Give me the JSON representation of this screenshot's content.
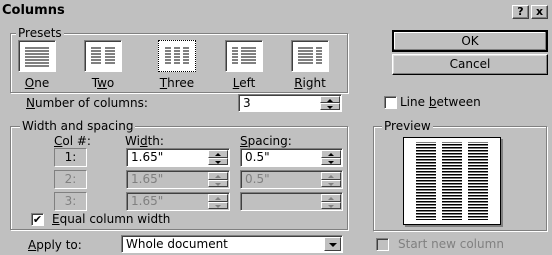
{
  "dialog": {
    "title": "Columns",
    "help_label": "?",
    "close_label": "x"
  },
  "presets": {
    "label": "Presets",
    "items": [
      {
        "label": "One",
        "mnemonic": "O",
        "rest": "ne"
      },
      {
        "label": "Two",
        "mnemonic_pre": "T",
        "mnemonic": "w",
        "rest": "o"
      },
      {
        "label": "Three",
        "mnemonic": "T",
        "rest": "hree"
      },
      {
        "label": "Left",
        "mnemonic": "L",
        "rest": "eft"
      },
      {
        "label": "Right",
        "mnemonic": "R",
        "rest": "ight"
      }
    ]
  },
  "buttons": {
    "ok": "OK",
    "cancel": "Cancel"
  },
  "number_of_columns": {
    "label_mnemonic": "N",
    "label_rest": "umber of columns:",
    "value": "3"
  },
  "line_between": {
    "label_pre": "Line ",
    "label_mnemonic": "b",
    "label_rest": "etween",
    "checked": false
  },
  "width_spacing": {
    "label": "Width and spacing",
    "col_header_mnemonic": "C",
    "col_header_rest": "ol #:",
    "width_header_pre": "Wi",
    "width_header_mnemonic": "d",
    "width_header_rest": "th:",
    "spacing_header_mnemonic": "S",
    "spacing_header_rest": "pacing:",
    "rows": [
      {
        "col": "1:",
        "width": "1.65\"",
        "spacing": "0.5\"",
        "enabled": true
      },
      {
        "col": "2:",
        "width": "1.65\"",
        "spacing": "0.5\"",
        "enabled": false
      },
      {
        "col": "3:",
        "width": "1.65\"",
        "spacing": "",
        "enabled": false
      }
    ]
  },
  "equal_column_width": {
    "label_mnemonic": "E",
    "label_rest": "qual column width",
    "checked": true
  },
  "preview": {
    "label": "Preview"
  },
  "apply_to": {
    "label_mnemonic": "A",
    "label_rest": "pply to:",
    "value": "Whole document"
  },
  "start_new_column": {
    "label": "Start new column",
    "checked": false,
    "enabled": false
  }
}
